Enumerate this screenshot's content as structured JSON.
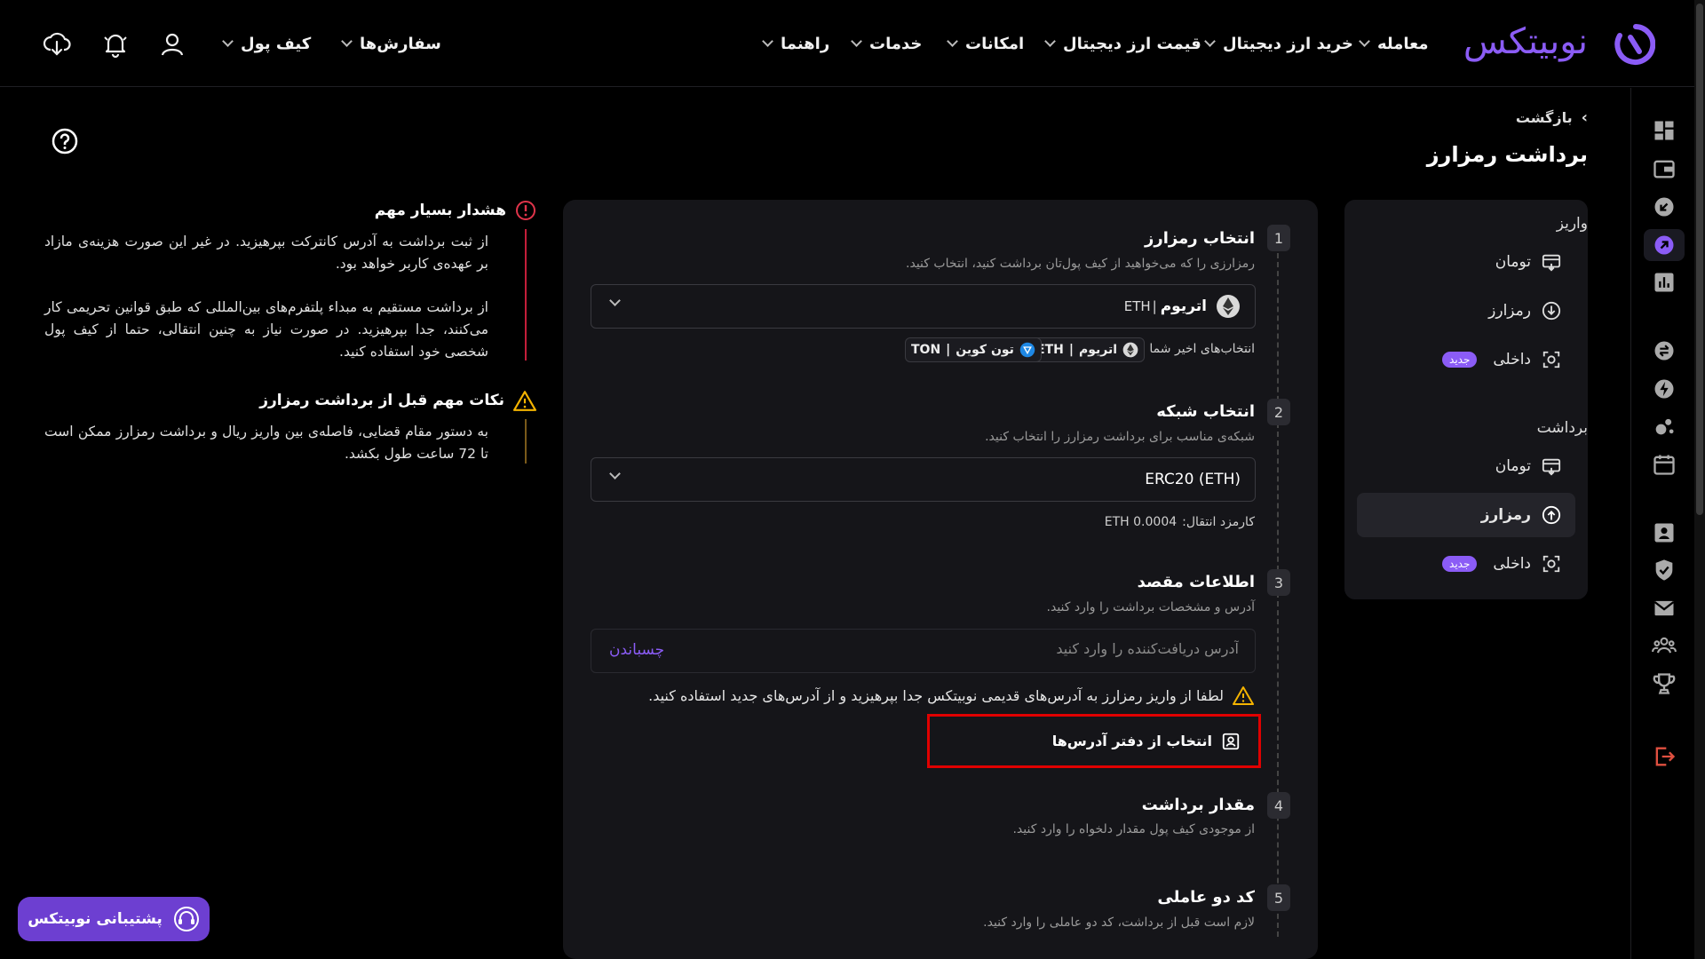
{
  "brand": {
    "name": "نوبیتکس",
    "color": "#8b5cf6"
  },
  "nav": {
    "items": [
      {
        "label": "معامله"
      },
      {
        "label": "خرید ارز دیجیتال"
      },
      {
        "label": "قیمت ارز دیجیتال"
      },
      {
        "label": "امکانات"
      },
      {
        "label": "خدمات"
      },
      {
        "label": "راهنما"
      }
    ],
    "right_items": [
      {
        "label": "سفارش‌ها"
      },
      {
        "label": "کیف پول"
      }
    ]
  },
  "breadcrumb": {
    "back": "بازگشت"
  },
  "page": {
    "title": "برداشت رمزارز"
  },
  "side_menu": {
    "deposit_heading": "واریز",
    "deposit_items": [
      {
        "label": "تومان",
        "icon": "bank-card-icon"
      },
      {
        "label": "رمزارز",
        "icon": "crypto-down-icon"
      },
      {
        "label": "داخلی",
        "icon": "scan-icon",
        "badge": "جدید"
      }
    ],
    "withdraw_heading": "برداشت",
    "withdraw_items": [
      {
        "label": "تومان",
        "icon": "bank-card-icon"
      },
      {
        "label": "رمزارز",
        "icon": "crypto-up-icon"
      },
      {
        "label": "داخلی",
        "icon": "scan-icon",
        "badge": "جدید"
      }
    ]
  },
  "steps": {
    "s1": {
      "num": "1",
      "title": "انتخاب رمزارز",
      "desc": "رمزارزی را که می‌خواهید از کیف پول‌تان برداشت کنید، انتخاب کنید.",
      "selected_name": "اتریوم",
      "selected_sym": "ETH",
      "sep": "|",
      "recent_label": "انتخاب‌های اخیر شما",
      "recent": [
        {
          "name": "اتریوم",
          "sym": "ETH"
        },
        {
          "name": "تون کوین",
          "sym": "TON"
        }
      ]
    },
    "s2": {
      "num": "2",
      "title": "انتخاب شبکه",
      "desc": "شبکه‌ی مناسب برای برداشت رمزارز را انتخاب کنید.",
      "selected": "ERC20 (ETH)",
      "fee_label": "کارمزد انتقال:",
      "fee_value": "ETH 0.0004"
    },
    "s3": {
      "num": "3",
      "title": "اطلاعات مقصد",
      "desc": "آدرس و مشخصات برداشت را وارد کنید.",
      "address_placeholder": "آدرس دریافت‌کننده را وارد کنید",
      "paste": "چسباندن",
      "warning": "لطفا از واریز رمزارز به آدرس‌های قدیمی نوبیتکس جدا بپرهیزید و از آدرس‌های جدید استفاده کنید.",
      "address_book": "انتخاب از دفتر آدرس‌ها"
    },
    "s4": {
      "num": "4",
      "title": "مقدار برداشت",
      "desc": "از موجودی کیف پول مقدار دلخواه را وارد کنید."
    },
    "s5": {
      "num": "5",
      "title": "کد دو عاملی",
      "desc": "لازم است قبل از برداشت، کد دو عاملی را وارد کنید."
    }
  },
  "warnings": {
    "critical_title": "هشدار بسیار مهم",
    "critical_p1": "از ثبت برداشت به آدرس کانترکت بپرهیزید. در غیر این صورت هزینه‌ی مازاد بر عهده‌ی کاربر خواهد بود.",
    "critical_p2": "از برداشت مستقیم به مبداء پلتفرم‌های بین‌المللی که طبق قوانین تحریمی کار می‌کنند، جدا بپرهیزید. در صورت نیاز به چنین انتقالی، حتما از کیف پول شخصی خود استفاده کنید.",
    "notes_title": "نکات مهم قبل از برداشت رمزارز",
    "notes_p1": "به دستور مقام قضایی، فاصله‌ی بین واریز ریال و برداشت رمزارز ممکن است تا 72 ساعت طول بکشد."
  },
  "support": {
    "label": "پشتیبانی نوبیتکس"
  }
}
